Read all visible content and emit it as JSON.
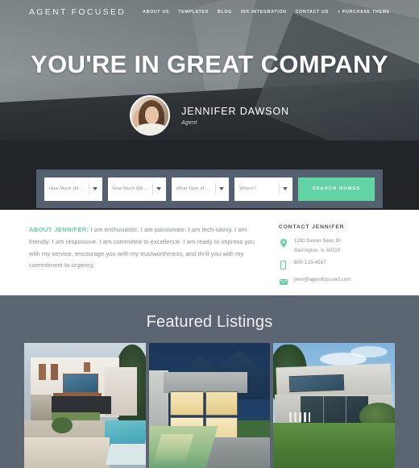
{
  "header": {
    "logo": "AGENT FOCUSED",
    "nav": [
      {
        "label": "ABOUT US"
      },
      {
        "label": "TEMPLATES"
      },
      {
        "label": "BLOG"
      },
      {
        "label": "IDX INTEGRATION"
      },
      {
        "label": "CONTACT US"
      },
      {
        "label": "+ PURCHASE THEME"
      }
    ]
  },
  "hero": {
    "title": "YOU'RE IN GREAT COMPANY",
    "agent_name": "JENNIFER DAWSON",
    "agent_role": "Agent"
  },
  "search": {
    "fields": [
      {
        "label": "How Much (Max)?"
      },
      {
        "label": "How Much (Min)?"
      },
      {
        "label": "What Type of Home?"
      },
      {
        "label": "Where?"
      }
    ],
    "button_label": "SEARCH HOMES"
  },
  "about": {
    "lead": "ABOUT JENNIFER:",
    "body": " I am enthusiastic. I am passionate. I am tech-savvy. I am friendly. I am responsive. I am committed to excellence. I am ready to impress you with my service, encourage you with my trustworthiness, and thrill you with my commitment to urgency."
  },
  "contact": {
    "title": "CONTACT JENNIFER",
    "address_line1": "1180 Seven Seas Dr.",
    "address_line2": "Barrington, IL 60110",
    "phone": "800-123-4567",
    "email": "jenn@agentfocused.com",
    "icons": {
      "location": "map-pin-icon",
      "phone": "mobile-phone-icon",
      "email": "envelope-icon"
    }
  },
  "featured": {
    "title": "Featured Listings",
    "listings": [
      {
        "name": "listing-white-villa-pool"
      },
      {
        "name": "listing-glass-house-dusk"
      },
      {
        "name": "listing-concrete-house-lawn"
      }
    ]
  },
  "colors": {
    "accent_green": "#62d3a3",
    "search_bar_bg": "#54606f",
    "featured_bg": "#5b6672",
    "hero_dark": "#23262a",
    "body_text": "#8a9197"
  }
}
